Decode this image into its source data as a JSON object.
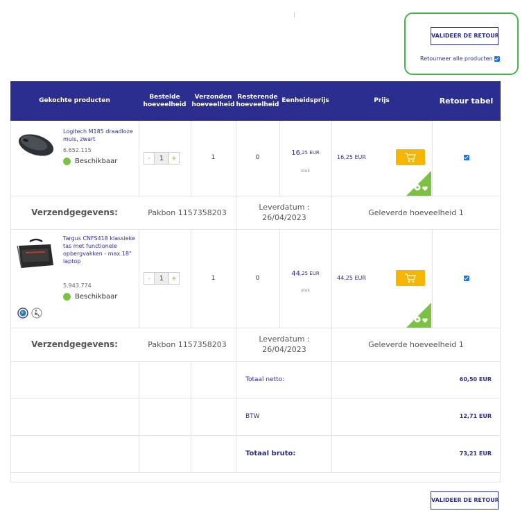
{
  "top": {
    "validate_label": "VALIDEER DE RETOUR",
    "return_all_label": "Retourneer alle producten"
  },
  "headers": {
    "products": "Gekochte producten",
    "ordered": "Bestelde hoeveelheid",
    "shipped": "Verzonden hoeveelheid",
    "remaining": "Resterende hoeveelheid",
    "unit_price": "Eenheidsprijs",
    "price": "Prijs",
    "return": "Retour tabel"
  },
  "items": [
    {
      "name": "Logitech M185 draadloze muis, zwart",
      "sku": "6.652.115",
      "availability": "Beschikbaar",
      "quantity": "1",
      "shipped": "1",
      "remaining": "0",
      "unit_price_main": "16",
      "unit_price_rest": ",25 EUR",
      "unit": "stuk",
      "price": "16,25 EUR",
      "shipping_label": "Verzendgegevens:",
      "packing_slip": "Pakbon 1157358203",
      "delivery_date": "Leverdatum : 26/04/2023",
      "delivered_qty": "Geleverde hoeveelheid 1"
    },
    {
      "name": "Targus CNFS418 klassieke tas met functionele opbergvakken - max.18\" laptop",
      "sku": "5.943.774",
      "availability": "Beschikbaar",
      "quantity": "1",
      "shipped": "1",
      "remaining": "0",
      "unit_price_main": "44",
      "unit_price_rest": ",25 EUR",
      "unit": "stuk",
      "price": "44,25 EUR",
      "shipping_label": "Verzendgegevens:",
      "packing_slip": "Pakbon 1157358203",
      "delivery_date": "Leverdatum : 26/04/2023",
      "delivered_qty": "Geleverde hoeveelheid 1"
    }
  ],
  "totals": {
    "net_label": "Totaal netto:",
    "net_value": "60,50 EUR",
    "vat_label": "BTW",
    "vat_value": "12,71 EUR",
    "gross_label": "Totaal bruto:",
    "gross_value": "73,21 EUR"
  },
  "bottom": {
    "validate_label": "VALIDEER DE RETOUR"
  },
  "colors": {
    "header_bg": "#2b2e8f",
    "accent_green": "#7cc242",
    "cart_yellow": "#f6b500",
    "checkbox_blue": "#1e73d8"
  },
  "icons": [
    "shopping-cart-icon",
    "add-favorite-icon",
    "globe-icon",
    "accessibility-icon"
  ]
}
